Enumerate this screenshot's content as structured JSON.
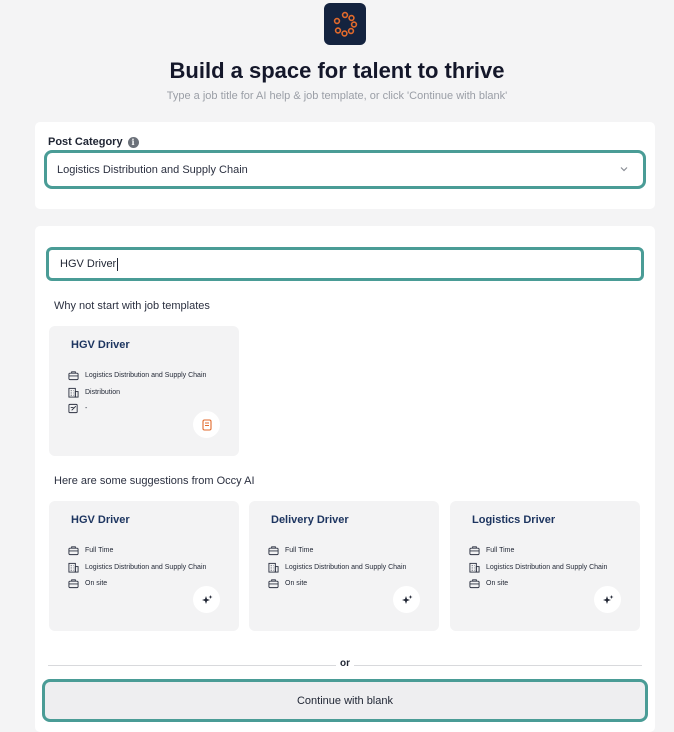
{
  "header": {
    "title": "Build a space for talent to thrive",
    "subtitle": "Type a job title for AI help & job template, or click 'Continue with blank'"
  },
  "category": {
    "label": "Post Category",
    "selected": "Logistics Distribution and Supply Chain"
  },
  "search": {
    "value": "HGV Driver"
  },
  "templates": {
    "heading": "Why not start with job templates",
    "items": [
      {
        "title": "HGV Driver",
        "category": "Logistics Distribution and Supply Chain",
        "department": "Distribution",
        "type": "-"
      }
    ]
  },
  "suggestions": {
    "heading": "Here are some suggestions from Occy AI",
    "items": [
      {
        "title": "HGV Driver",
        "employment": "Full Time",
        "category": "Logistics Distribution and Supply Chain",
        "location": "On site"
      },
      {
        "title": "Delivery Driver",
        "employment": "Full Time",
        "category": "Logistics Distribution and Supply Chain",
        "location": "On site"
      },
      {
        "title": "Logistics Driver",
        "employment": "Full Time",
        "category": "Logistics Distribution and Supply Chain",
        "location": "On site"
      }
    ]
  },
  "divider_text": "or",
  "continue_label": "Continue with blank",
  "colors": {
    "accent_border": "#4a9c96",
    "title_blue": "#1d3560",
    "logo_bg": "#14233f",
    "logo_ring": "#e26a2c",
    "template_icon": "#e26a2c"
  }
}
